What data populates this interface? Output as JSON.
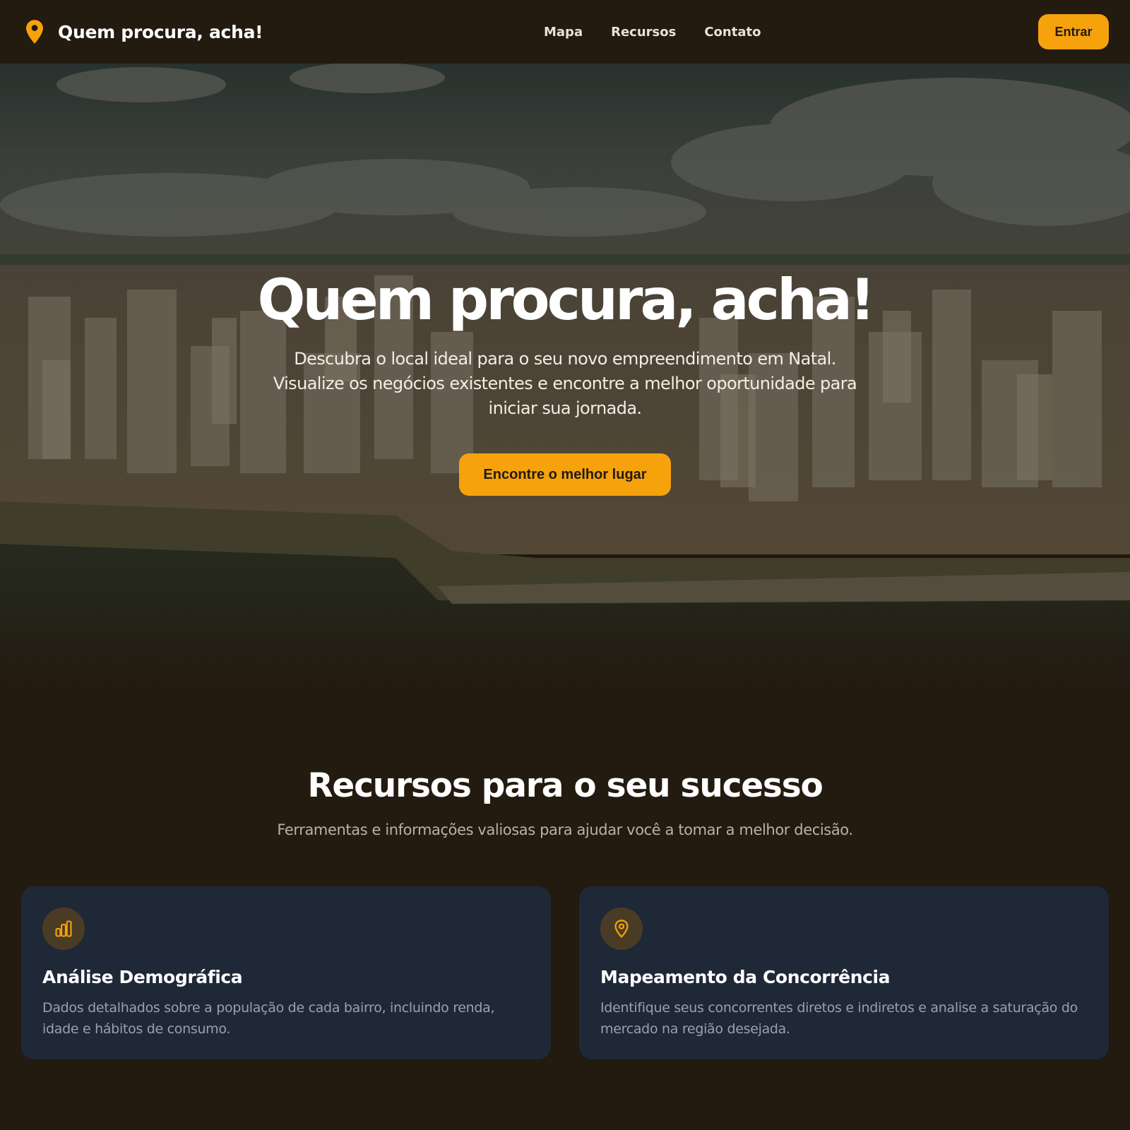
{
  "header": {
    "brand_icon": "map-pin-icon",
    "brand_title": "Quem procura, acha!",
    "nav": [
      {
        "label": "Mapa"
      },
      {
        "label": "Recursos"
      },
      {
        "label": "Contato"
      }
    ],
    "login_label": "Entrar"
  },
  "hero": {
    "background": "aerial-city-photo",
    "title": "Quem procura, acha!",
    "subtitle": "Descubra o local ideal para o seu novo empreendimento em Natal. Visualize os negócios existentes e encontre a melhor oportunidade para iniciar sua jornada.",
    "cta_label": "Encontre o melhor lugar"
  },
  "features": {
    "title": "Recursos para o seu sucesso",
    "subtitle": "Ferramentas e informações valiosas para ajudar você a tomar a melhor decisão.",
    "cards": [
      {
        "icon": "bar-chart-icon",
        "title": "Análise Demográfica",
        "text": "Dados detalhados sobre a população de cada bairro, incluindo renda, idade e hábitos de consumo."
      },
      {
        "icon": "map-pin-icon",
        "title": "Mapeamento da Concorrência",
        "text": "Identifique seus concorrentes diretos e indiretos e analise a saturação do mercado na região desejada."
      }
    ]
  },
  "colors": {
    "background": "#231a10",
    "accent": "#f5a20c",
    "card": "#1f2837",
    "icon_bg": "#4a3c24"
  }
}
